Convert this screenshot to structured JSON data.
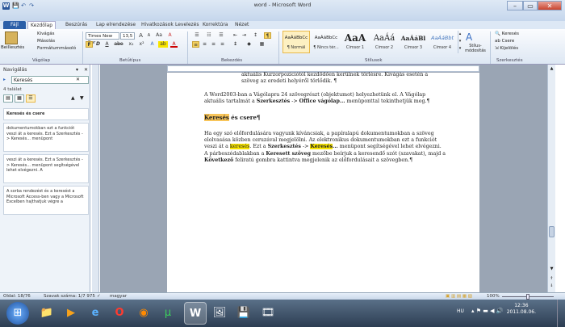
{
  "window": {
    "title": "word - Microsoft Word",
    "min": "–",
    "max": "▭",
    "close": "✕",
    "app_letter": "W"
  },
  "quick_access": [
    "💾",
    "↶",
    "↷"
  ],
  "ribbon_tabs": [
    "Fájl",
    "Kezdőlap",
    "Beszúrás",
    "Lap elrendezése",
    "Hivatkozások",
    "Levelezés",
    "Korrektúra",
    "Nézet"
  ],
  "clipboard": {
    "paste": "Beillesztés",
    "cut": "Kivágás",
    "copy": "Másolás",
    "format_painter": "Formátummásoló",
    "label": "Vágólap"
  },
  "font": {
    "name": "Times New Ror",
    "size": "13,5",
    "label": "Betűtípus",
    "grow": "A",
    "shrink": "A",
    "aa": "Aa",
    "clear": "A",
    "bold": "F",
    "italic": "D",
    "underline": "A",
    "strike": "abe",
    "sub": "x₂",
    "sup": "x²",
    "effects": "A",
    "highlight": "ab",
    "color": "A"
  },
  "paragraph": {
    "label": "Bekezdés",
    "pilcrow": "¶"
  },
  "styles": {
    "label": "Stílusok",
    "items": [
      {
        "preview": "AaÁáBbCc",
        "name": "¶ Normál"
      },
      {
        "preview": "AaÁáBbCc",
        "name": "¶ Nincs tér..."
      },
      {
        "preview": "AaA",
        "name": "Címsor 1"
      },
      {
        "preview": "AaÁá",
        "name": "Címsor 2"
      },
      {
        "preview": "AaÁáBl",
        "name": "Címsor 3"
      },
      {
        "preview": "AaÁáBbt",
        "name": "Címsor 4"
      }
    ],
    "change": "Stílus-módosítás"
  },
  "editing": {
    "label": "Szerkesztés",
    "find": "Keresés",
    "replace": "Csere",
    "select": "Kijelölés"
  },
  "nav": {
    "title": "Navigálás",
    "search_value": "Keresés",
    "count": "4 találat",
    "results": [
      "Keresés és csere",
      "dokumentumokban ezt a funkciót veszi át a keresés. Ezt a Szerkesztés -> Keresés... menüpont",
      "veszi át a keresés. Ezt a Szerkesztés -> Keresés... menüpont segítségével lehet elvégezni. A",
      "A sorba rendezést és a keresést a Microsoft Access-ben vagy a Microsoft Excelben hajthatjuk végre a"
    ]
  },
  "doc": {
    "line_top": "aktuális Kurzorpozíciótól kezdődően kerülnek törlésre. Kivágás esetén a szöveg az eredeti helyéről törlődik. ¶",
    "para1": "A Word2003-ban a Vágólapra 24 szövegrészt (objektumot) helyezhetünk el. A Vágólap aktuális tartalmát a Szerkesztés -> Office vágólap... menüponttal tekinthetjük meg.¶",
    "heading_hl": "Keresés",
    "heading_rest": " és csere¶",
    "para2": "Ha egy szó előfordulására vagyunk kíváncsiak, a papíralapú dokumentumokban a szöveg elolvasása közben ceruzával megjelölni. Az elektronikus dokumentumokban ezt a funkciót veszi át a keresés. Ezt a Szerkesztés -> Keresés... menüpont segítségével lehet elvégezni. A párbeszédablakban a Keresett szöveg mezőbe beírjuk a keresendő szót (szavakat), majd a Következő feliratú gombra kattintva megjelenik az előfordulásait a szövegben.¶"
  },
  "status": {
    "page": "Oldal: 18/76",
    "words": "Szavak száma: 1/7 975",
    "lang": "magyar",
    "zoom": "100%"
  },
  "taskbar": {
    "time": "12:36",
    "date": "2011.08.06.",
    "lang": "HU"
  }
}
